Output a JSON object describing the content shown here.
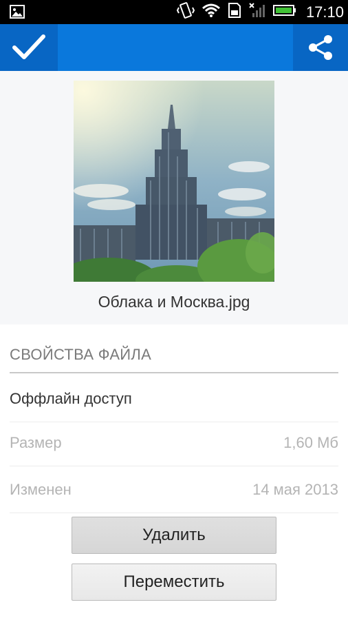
{
  "status_bar": {
    "time": "17:10",
    "icons": [
      "gallery-notification-icon",
      "vibrate-icon",
      "wifi-icon",
      "sd-card-icon",
      "signal-icon",
      "battery-icon"
    ]
  },
  "action_bar": {
    "confirm_icon": "check-icon",
    "share_icon": "share-icon",
    "color": "#0a78dc"
  },
  "file": {
    "name": "Облака и Москва.jpg"
  },
  "properties": {
    "header": "СВОЙСТВА ФАЙЛА",
    "offline_label": "Оффлайн доступ",
    "size_label": "Размер",
    "size_value": "1,60 Мб",
    "modified_label": "Изменен",
    "modified_value": "14 мая 2013"
  },
  "buttons": {
    "delete_label": "Удалить",
    "move_label": "Переместить"
  }
}
